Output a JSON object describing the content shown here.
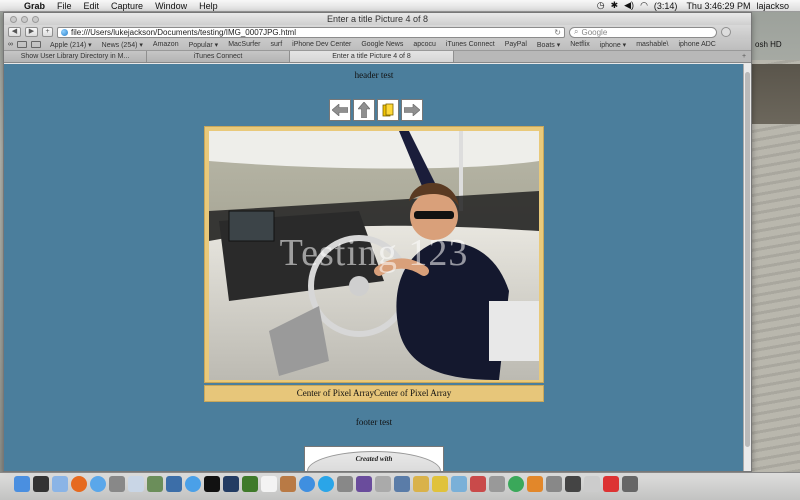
{
  "menubar": {
    "app": "Grab",
    "items": [
      "File",
      "Edit",
      "Capture",
      "Window",
      "Help"
    ],
    "battery": "(3:14)",
    "clock": "Thu 3:46:29 PM",
    "user": "lajackso"
  },
  "window": {
    "title": "Enter a title Picture 4 of 8",
    "url": "file:///Users/lukejackson/Documents/testing/IMG_0007JPG.html",
    "search_placeholder": "Google"
  },
  "bookmarks": [
    "Apple (214) ▾",
    "News (254) ▾",
    "Amazon",
    "Popular ▾",
    "MacSurfer",
    "surf",
    "iPhone Dev Center",
    "Google News",
    "apcocu",
    "iTunes Connect",
    "PayPal",
    "Boats ▾",
    "Netflix",
    "iphone ▾",
    "mashable\\",
    "iphone ADC"
  ],
  "tabs": [
    "Show User Library Directory in M...",
    "iTunes Connect",
    "Enter a title Picture 4 of 8"
  ],
  "page": {
    "header": "header test",
    "watermark": "Testing 123",
    "caption": "Center of Pixel ArrayCenter of Pixel Array",
    "footer": "footer test",
    "badge": "Created with"
  },
  "desktop": {
    "drive_label": "osh HD"
  },
  "colors": {
    "page_bg": "#4b7e9c",
    "frame": "#e9c97a"
  }
}
